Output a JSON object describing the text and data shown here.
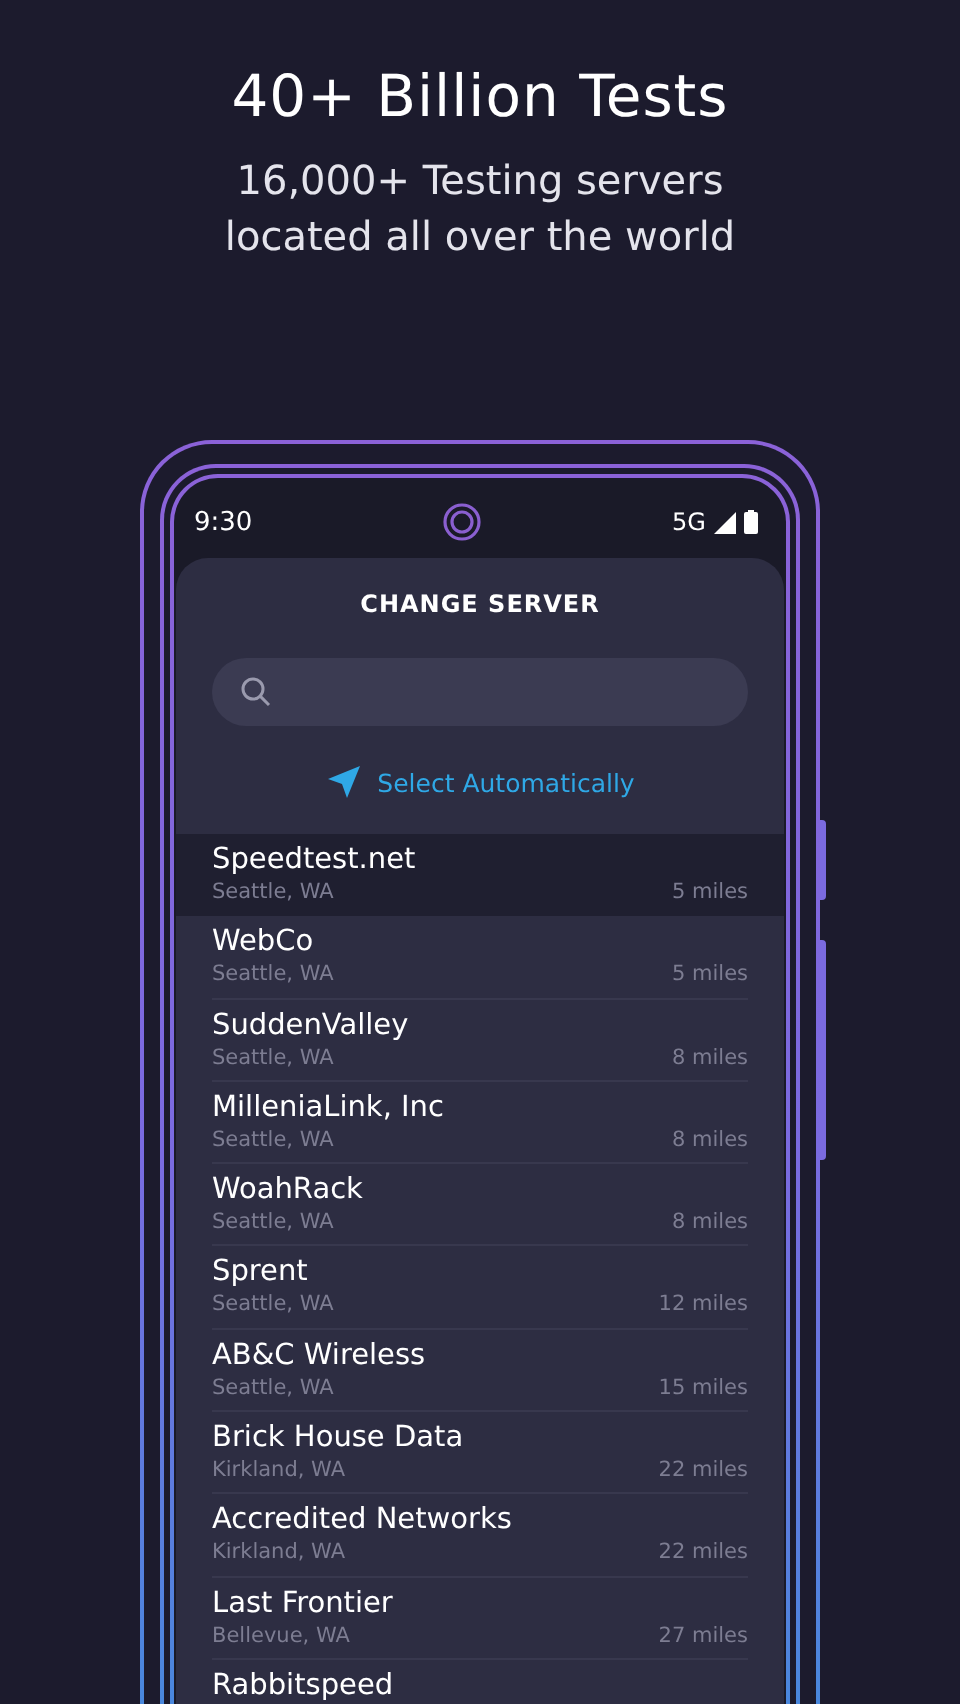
{
  "headline": "40+ Billion Tests",
  "subtitle": "16,000+ Testing servers\nlocated all over the world",
  "status_bar": {
    "time": "9:30",
    "network": "5G"
  },
  "screen": {
    "title": "CHANGE SERVER",
    "auto_select": "Select Automatically",
    "servers": [
      {
        "name": "Speedtest.net",
        "location": "Seattle, WA",
        "distance": "5 miles",
        "selected": true
      },
      {
        "name": "WebCo",
        "location": "Seattle, WA",
        "distance": "5 miles",
        "selected": false
      },
      {
        "name": "SuddenValley",
        "location": "Seattle, WA",
        "distance": "8 miles",
        "selected": false
      },
      {
        "name": "MilleniaLink, Inc",
        "location": "Seattle, WA",
        "distance": "8 miles",
        "selected": false
      },
      {
        "name": "WoahRack",
        "location": "Seattle, WA",
        "distance": "8 miles",
        "selected": false
      },
      {
        "name": "Sprent",
        "location": "Seattle, WA",
        "distance": "12 miles",
        "selected": false
      },
      {
        "name": "AB&C Wireless",
        "location": "Seattle, WA",
        "distance": "15 miles",
        "selected": false
      },
      {
        "name": "Brick House Data",
        "location": "Kirkland, WA",
        "distance": "22 miles",
        "selected": false
      },
      {
        "name": "Accredited Networks",
        "location": "Kirkland, WA",
        "distance": "22 miles",
        "selected": false
      },
      {
        "name": "Last Frontier",
        "location": "Bellevue, WA",
        "distance": "27 miles",
        "selected": false
      },
      {
        "name": "Rabbitspeed",
        "selected": false
      }
    ]
  }
}
